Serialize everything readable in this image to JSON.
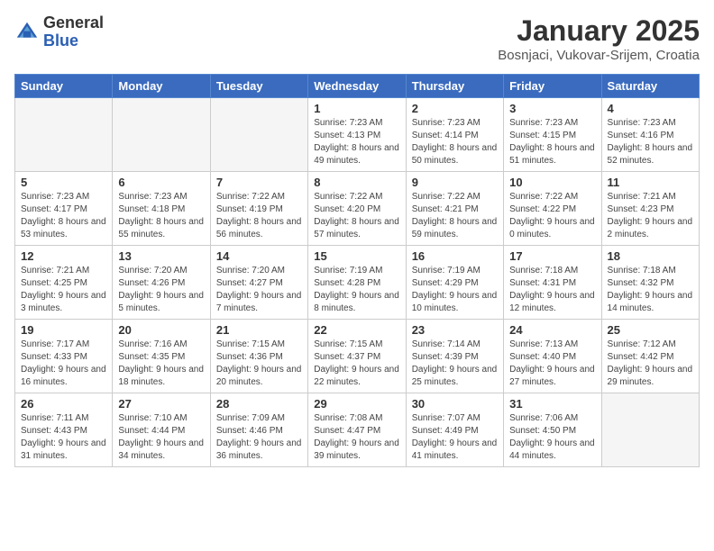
{
  "header": {
    "logo_general": "General",
    "logo_blue": "Blue",
    "title": "January 2025",
    "subtitle": "Bosnjaci, Vukovar-Srijem, Croatia"
  },
  "days_of_week": [
    "Sunday",
    "Monday",
    "Tuesday",
    "Wednesday",
    "Thursday",
    "Friday",
    "Saturday"
  ],
  "weeks": [
    [
      {
        "day": "",
        "info": ""
      },
      {
        "day": "",
        "info": ""
      },
      {
        "day": "",
        "info": ""
      },
      {
        "day": "1",
        "info": "Sunrise: 7:23 AM\nSunset: 4:13 PM\nDaylight: 8 hours and 49 minutes."
      },
      {
        "day": "2",
        "info": "Sunrise: 7:23 AM\nSunset: 4:14 PM\nDaylight: 8 hours and 50 minutes."
      },
      {
        "day": "3",
        "info": "Sunrise: 7:23 AM\nSunset: 4:15 PM\nDaylight: 8 hours and 51 minutes."
      },
      {
        "day": "4",
        "info": "Sunrise: 7:23 AM\nSunset: 4:16 PM\nDaylight: 8 hours and 52 minutes."
      }
    ],
    [
      {
        "day": "5",
        "info": "Sunrise: 7:23 AM\nSunset: 4:17 PM\nDaylight: 8 hours and 53 minutes."
      },
      {
        "day": "6",
        "info": "Sunrise: 7:23 AM\nSunset: 4:18 PM\nDaylight: 8 hours and 55 minutes."
      },
      {
        "day": "7",
        "info": "Sunrise: 7:22 AM\nSunset: 4:19 PM\nDaylight: 8 hours and 56 minutes."
      },
      {
        "day": "8",
        "info": "Sunrise: 7:22 AM\nSunset: 4:20 PM\nDaylight: 8 hours and 57 minutes."
      },
      {
        "day": "9",
        "info": "Sunrise: 7:22 AM\nSunset: 4:21 PM\nDaylight: 8 hours and 59 minutes."
      },
      {
        "day": "10",
        "info": "Sunrise: 7:22 AM\nSunset: 4:22 PM\nDaylight: 9 hours and 0 minutes."
      },
      {
        "day": "11",
        "info": "Sunrise: 7:21 AM\nSunset: 4:23 PM\nDaylight: 9 hours and 2 minutes."
      }
    ],
    [
      {
        "day": "12",
        "info": "Sunrise: 7:21 AM\nSunset: 4:25 PM\nDaylight: 9 hours and 3 minutes."
      },
      {
        "day": "13",
        "info": "Sunrise: 7:20 AM\nSunset: 4:26 PM\nDaylight: 9 hours and 5 minutes."
      },
      {
        "day": "14",
        "info": "Sunrise: 7:20 AM\nSunset: 4:27 PM\nDaylight: 9 hours and 7 minutes."
      },
      {
        "day": "15",
        "info": "Sunrise: 7:19 AM\nSunset: 4:28 PM\nDaylight: 9 hours and 8 minutes."
      },
      {
        "day": "16",
        "info": "Sunrise: 7:19 AM\nSunset: 4:29 PM\nDaylight: 9 hours and 10 minutes."
      },
      {
        "day": "17",
        "info": "Sunrise: 7:18 AM\nSunset: 4:31 PM\nDaylight: 9 hours and 12 minutes."
      },
      {
        "day": "18",
        "info": "Sunrise: 7:18 AM\nSunset: 4:32 PM\nDaylight: 9 hours and 14 minutes."
      }
    ],
    [
      {
        "day": "19",
        "info": "Sunrise: 7:17 AM\nSunset: 4:33 PM\nDaylight: 9 hours and 16 minutes."
      },
      {
        "day": "20",
        "info": "Sunrise: 7:16 AM\nSunset: 4:35 PM\nDaylight: 9 hours and 18 minutes."
      },
      {
        "day": "21",
        "info": "Sunrise: 7:15 AM\nSunset: 4:36 PM\nDaylight: 9 hours and 20 minutes."
      },
      {
        "day": "22",
        "info": "Sunrise: 7:15 AM\nSunset: 4:37 PM\nDaylight: 9 hours and 22 minutes."
      },
      {
        "day": "23",
        "info": "Sunrise: 7:14 AM\nSunset: 4:39 PM\nDaylight: 9 hours and 25 minutes."
      },
      {
        "day": "24",
        "info": "Sunrise: 7:13 AM\nSunset: 4:40 PM\nDaylight: 9 hours and 27 minutes."
      },
      {
        "day": "25",
        "info": "Sunrise: 7:12 AM\nSunset: 4:42 PM\nDaylight: 9 hours and 29 minutes."
      }
    ],
    [
      {
        "day": "26",
        "info": "Sunrise: 7:11 AM\nSunset: 4:43 PM\nDaylight: 9 hours and 31 minutes."
      },
      {
        "day": "27",
        "info": "Sunrise: 7:10 AM\nSunset: 4:44 PM\nDaylight: 9 hours and 34 minutes."
      },
      {
        "day": "28",
        "info": "Sunrise: 7:09 AM\nSunset: 4:46 PM\nDaylight: 9 hours and 36 minutes."
      },
      {
        "day": "29",
        "info": "Sunrise: 7:08 AM\nSunset: 4:47 PM\nDaylight: 9 hours and 39 minutes."
      },
      {
        "day": "30",
        "info": "Sunrise: 7:07 AM\nSunset: 4:49 PM\nDaylight: 9 hours and 41 minutes."
      },
      {
        "day": "31",
        "info": "Sunrise: 7:06 AM\nSunset: 4:50 PM\nDaylight: 9 hours and 44 minutes."
      },
      {
        "day": "",
        "info": ""
      }
    ]
  ]
}
